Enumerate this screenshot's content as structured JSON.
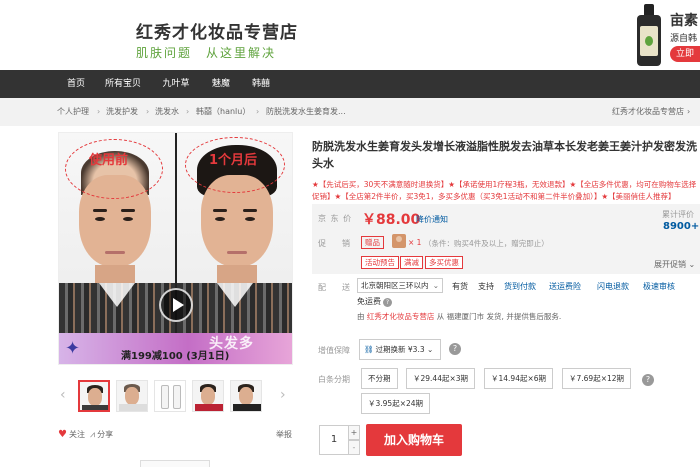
{
  "header": {
    "shop_name": "红秀才化妆品专营店",
    "slogan": "肌肤问题　从这里解决",
    "promo_brand": "亩素",
    "promo_sub": "源自韩",
    "promo_buy": "立即"
  },
  "nav": {
    "items": [
      "首页",
      "所有宝贝",
      "九叶草",
      "魅魔",
      "韩囍"
    ]
  },
  "breadcrumb": {
    "items": [
      "个人护理",
      "洗发护发",
      "洗发水",
      "韩囍（hanlu）",
      "防脱洗发水生姜育发..."
    ],
    "separator": "›",
    "shop": "红秀才化妆品专营店",
    "shop_chevron": "›"
  },
  "gallery": {
    "before_label": "使用前",
    "after_label": "1个月后",
    "band_text": "满199减100 (3月1日)",
    "band_brush": "头发多",
    "prev": "‹",
    "next": "›",
    "follow": "关注",
    "share": "分享",
    "report": "举报"
  },
  "product": {
    "title": "防脱洗发水生姜育发头发增长液溢脂性脱发去油草本长发老姜王姜汁护发密发洗头水",
    "promo_line": "★【先试后买，30天不满意随时退换货】★【承诺使用1疗程3瓶，无效退款】★【全店多件优惠，均可在购物车选择促销】★【全店第2件半价，买3免1，多买多优惠（买3免1活动不和第二件半价叠加）】★【美丽俏佳人推荐】"
  },
  "price": {
    "label": "京 东 价",
    "value": "￥88.00",
    "notice": "降价通知",
    "review_label": "累计评价",
    "review_count": "8900+",
    "promo_label": "促　销",
    "gift_tag": "赠品",
    "gift_qty": "× 1",
    "gift_cond": "（条件：购买4件及以上，赠完即止）",
    "tags": [
      "活动预告",
      "满减",
      "多买优惠"
    ],
    "expand": "展开促销 ⌄"
  },
  "delivery": {
    "label": "配　送　至",
    "address": "北京朝阳区三环以内",
    "caret": "⌄",
    "services": [
      "有货",
      "支持",
      "货到付款",
      "送运费险",
      "闪电退款",
      "极速审核"
    ],
    "freight": "免运费",
    "qmark": "?",
    "sold_by_prefix": "由",
    "sold_by_shop": "红秀才化妆品专营店",
    "sold_by_suffix": "从 福建厦门市 发货, 并提供售后服务."
  },
  "options": {
    "warranty_label": "增值保障",
    "warranty_value": "过期换新 ¥3.3",
    "warranty_caret": "⌄",
    "help": "?",
    "installment_label": "白条分期",
    "installments": [
      "不分期",
      "￥29.44起×3期",
      "￥14.94起×6期",
      "￥7.69起×12期",
      "￥3.95起×24期"
    ]
  },
  "cart": {
    "qty": "1",
    "plus": "+",
    "minus": "-",
    "add_label": "加入购物车"
  },
  "colors": {
    "accent": "#e4393c",
    "nav_bg": "#333333",
    "link": "#005aa0",
    "slogan": "#5fa33d"
  }
}
